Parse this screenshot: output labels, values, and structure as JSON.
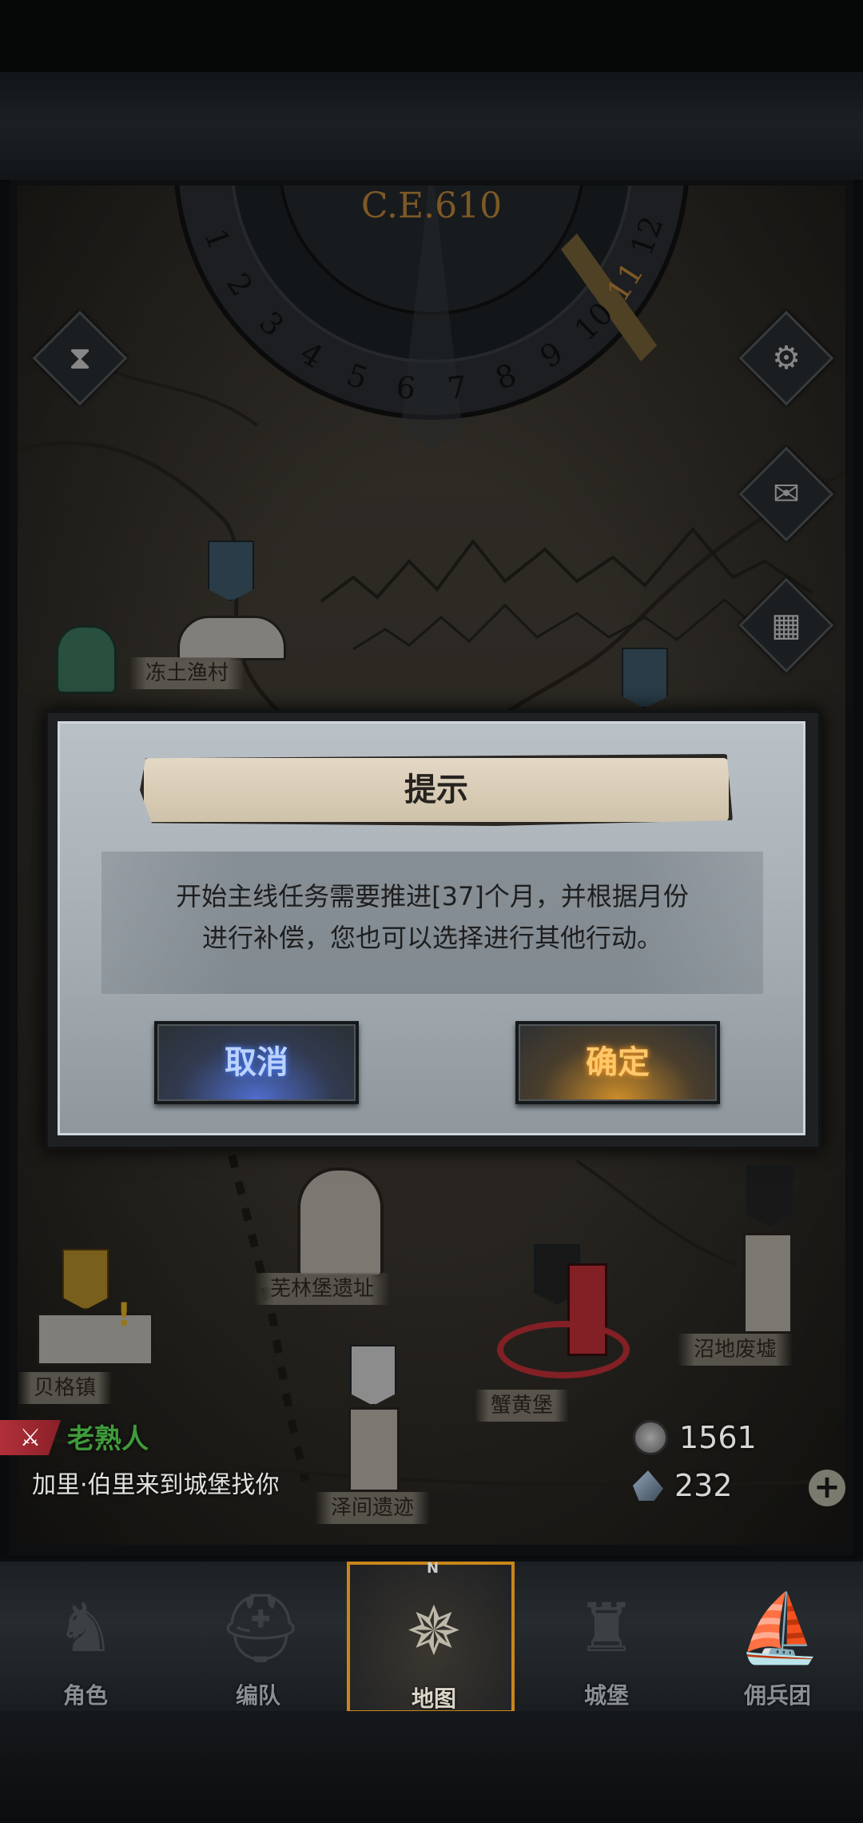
{
  "map": {
    "era": "C.E.610",
    "months": [
      "1",
      "2",
      "3",
      "4",
      "5",
      "6",
      "7",
      "8",
      "9",
      "10",
      "11",
      "12"
    ],
    "locations": [
      "冻土渔村",
      "芜林堡遗址",
      "贝格镇",
      "蟹黄堡",
      "沼地废墟",
      "泽间遗迹"
    ],
    "partial_label": "城"
  },
  "side_buttons": {
    "time_icon": "hourglass-icon",
    "settings_icon": "gear-icon",
    "mail_icon": "envelope-icon",
    "panel_icon": "window-icon"
  },
  "quest": {
    "name": "老熟人",
    "description": "加里·伯里来到城堡找你"
  },
  "resources": {
    "silver": "1561",
    "crystal": "232"
  },
  "dialog": {
    "title": "提示",
    "message_line1": "开始主线任务需要推进[37]个月，并根据月份",
    "message_line2": "进行补偿，您也可以选择进行其他行动。",
    "cancel_label": "取消",
    "confirm_label": "确定"
  },
  "nav": {
    "items": [
      {
        "label": "角色",
        "icon": "knight-icon"
      },
      {
        "label": "编队",
        "icon": "helmet-icon"
      },
      {
        "label": "地图",
        "icon": "compass-icon"
      },
      {
        "label": "城堡",
        "icon": "castle-icon"
      },
      {
        "label": "佣兵团",
        "icon": "ship-icon"
      }
    ],
    "active_index": 2,
    "compass_marker": "N"
  },
  "colors": {
    "accent_gold": "#c8861a",
    "quest_green": "#3f9b3a",
    "cancel_blue": "#4f6ecf",
    "confirm_orange": "#d08f2a"
  }
}
